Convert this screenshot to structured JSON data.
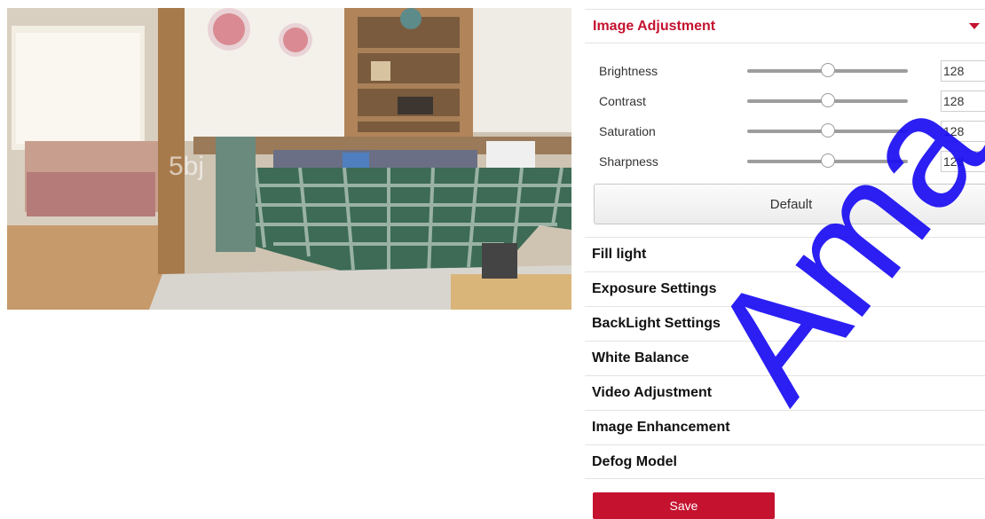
{
  "preview": {
    "watermark_text": "5bj"
  },
  "image_adjustment": {
    "title": "Image Adjustment",
    "expanded_icon": "caret-down-icon",
    "sliders": [
      {
        "label": "Brightness",
        "value": "128",
        "level": 0.5
      },
      {
        "label": "Contrast",
        "value": "128",
        "level": 0.5
      },
      {
        "label": "Saturation",
        "value": "128",
        "level": 0.5
      },
      {
        "label": "Sharpness",
        "value": "128",
        "level": 0.5
      }
    ],
    "default_label": "Default"
  },
  "menu": [
    "Fill light",
    "Exposure Settings",
    "BackLight Settings",
    "White Balance",
    "Video Adjustment",
    "Image Enhancement",
    "Defog Model"
  ],
  "save_label": "Save",
  "overlay_watermark": "Ama",
  "colors": {
    "accent": "#c4122f",
    "watermark": "#1a0df2"
  }
}
